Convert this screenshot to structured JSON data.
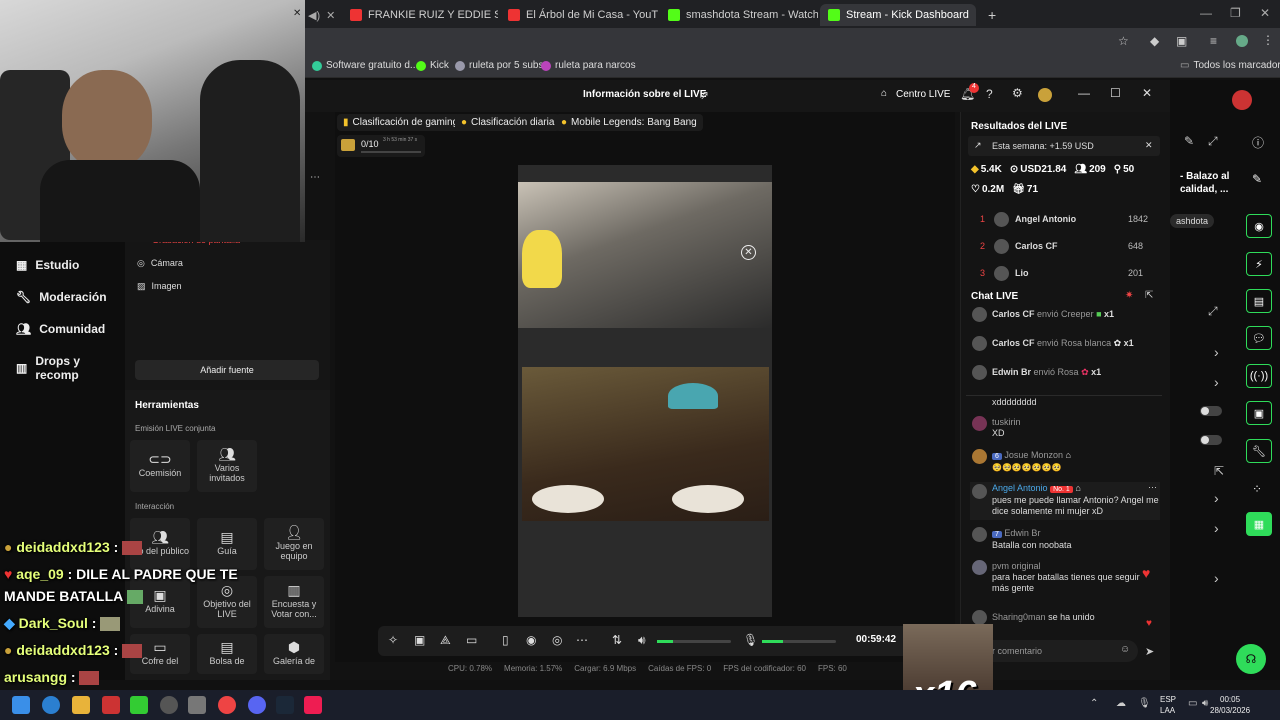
{
  "browser": {
    "tabs": [
      {
        "label": "FRANKIE RUIZ Y EDDIE SANTIAG",
        "color": "#e33"
      },
      {
        "label": "El Árbol de Mi Casa - YouTube",
        "color": "#e33"
      },
      {
        "label": "smashdota Stream - Watch Live",
        "color": "#53fc18"
      },
      {
        "label": "Stream - Kick Dashboard",
        "color": "#53fc18"
      }
    ],
    "new_tab": "+",
    "bookmarks": [
      "Software gratuito d...",
      "Kick",
      "ruleta por 5 subs",
      "ruleta para narcos"
    ],
    "all_bookmarks": "Todos los marcadores"
  },
  "app": {
    "title": "Información sobre el LIVE",
    "centro_live": "Centro LIVE",
    "notif_count": "4",
    "chips": [
      "Clasificación de gaming",
      "Clasificación diaria",
      "Mobile Legends: Bang Bang"
    ],
    "goal": "0/10",
    "goal_time": "3 h 53 min 37 s"
  },
  "leftnav": [
    "Estudio",
    "Moderación",
    "Comunidad",
    "Drops y recomp"
  ],
  "sources": {
    "partial": "Grabación de pantalla",
    "items": [
      "Cámara",
      "Imagen"
    ],
    "add": "Añadir fuente"
  },
  "tools": {
    "title": "Herramientas",
    "section1": "Emisión LIVE conjunta",
    "co": [
      "Coemisión",
      "Varios invitados"
    ],
    "section2": "Interacción",
    "row1": [
      "rito del público",
      "Guía",
      "Juego en equipo"
    ],
    "row2": [
      "Adivina",
      "Objetivo del LIVE",
      "Encuesta y Votar con..."
    ],
    "row3": [
      "Cofre del",
      "Bolsa de",
      "Galería de"
    ]
  },
  "controls": {
    "time": "00:59:42"
  },
  "stats": [
    "CPU: 0.78%",
    "Memoria: 1.57%",
    "Cargar: 6.9 Mbps",
    "Caídas de FPS: 0",
    "FPS del codificador: 60",
    "FPS: 60"
  ],
  "results": {
    "title": "Resultados del LIVE",
    "week": "Esta semana: +1.59 USD",
    "m1": "5.4K",
    "m2": "USD21.84",
    "m3": "209",
    "m4": "50",
    "m5": "0.2M",
    "m6": "71",
    "ranking": [
      {
        "rank": "1",
        "name": "Angel Antonio",
        "score": "1842"
      },
      {
        "rank": "2",
        "name": "Carlos CF",
        "score": "648"
      },
      {
        "rank": "3",
        "name": "Lio",
        "score": "201"
      }
    ]
  },
  "chat": {
    "title": "Chat LIVE",
    "gifts": [
      {
        "user": "Carlos CF",
        "text": "envió Creeper",
        "count": "x1"
      },
      {
        "user": "Carlos CF",
        "text": "envió Rosa blanca",
        "count": "x1"
      },
      {
        "user": "Edwin Br",
        "text": "envió Rosa",
        "count": "x1"
      }
    ],
    "partial": "xdddddddd",
    "messages": [
      {
        "user": "tuskirin",
        "text": "XD"
      },
      {
        "user": "Josue Monzon",
        "badge": "6",
        "text": "🥺🥺🥺🥺🥺🥺🥺"
      },
      {
        "user": "Angel Antonio",
        "badge": "No. 1",
        "text": "pues me puede llamar Antonio? Angel me dice solamente mi mujer xD"
      },
      {
        "user": "Edwin Br",
        "badge": "7",
        "text": "Batalla con noobata"
      },
      {
        "user": "pvm original",
        "text": "para hacer batallas tienes que seguir más gente"
      },
      {
        "user": "Sharing0man",
        "text": "se ha unido"
      }
    ],
    "input_placeholder": "ir comentario"
  },
  "sidepeek": {
    "text1": "- Balazo al",
    "text2": "calidad, ...",
    "tag": "ashdota"
  },
  "overlay_chat": [
    {
      "name": "deidaddxd123",
      "msg": ""
    },
    {
      "name": "aqe_09",
      "msg": "DILE AL PADRE QUE TE"
    },
    {
      "name": "",
      "msg": "MANDE BATALLA"
    },
    {
      "name": "Dark_Soul",
      "msg": ""
    },
    {
      "name": "deidaddxd123",
      "msg": ""
    },
    {
      "name": "arusangg",
      "msg": ""
    }
  ],
  "gift_overlay": "x16",
  "taskbar": {
    "lang": "ESP",
    "lang2": "LAA",
    "time": "00:05",
    "date": "28/03/2026"
  }
}
